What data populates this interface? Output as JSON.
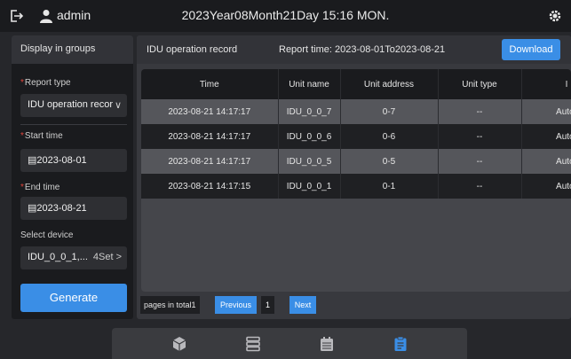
{
  "header": {
    "username": "admin",
    "datetime": "2023Year08Month21Day 15:16 MON."
  },
  "filters": {
    "title": "Display in groups",
    "report_type_label": "Report type",
    "report_type_value": "IDU operation recor",
    "start_time_label": "Start time",
    "start_time_value": "2023-08-01",
    "end_time_label": "End time",
    "end_time_value": "2023-08-21",
    "select_device_label": "Select device",
    "select_device_value": "IDU_0_0_1,...",
    "select_device_count": "4Set",
    "generate_label": "Generate"
  },
  "record": {
    "title": "IDU operation record",
    "report_time": "Report time: 2023-08-01To2023-08-21",
    "download_label": "Download",
    "columns": [
      "Time",
      "Unit name",
      "Unit address",
      "Unit type",
      "I"
    ],
    "rows": [
      [
        "2023-08-21 14:17:17",
        "IDU_0_0_7",
        "0-7",
        "--",
        "Auto-"
      ],
      [
        "2023-08-21 14:17:17",
        "IDU_0_0_6",
        "0-6",
        "--",
        "Auto-"
      ],
      [
        "2023-08-21 14:17:17",
        "IDU_0_0_5",
        "0-5",
        "--",
        "Auto-"
      ],
      [
        "2023-08-21 14:17:15",
        "IDU_0_0_1",
        "0-1",
        "--",
        "Auto-"
      ]
    ]
  },
  "pagination": {
    "total_label": "pages in total1",
    "previous_label": "Previous",
    "page": "1",
    "next_label": "Next"
  },
  "nav": {
    "icons": [
      "cube-icon",
      "server-icon",
      "calendar-icon",
      "report-icon"
    ],
    "active": "report-icon",
    "active_color": "#3a8ee6",
    "inactive_color": "#b9b9bd"
  }
}
